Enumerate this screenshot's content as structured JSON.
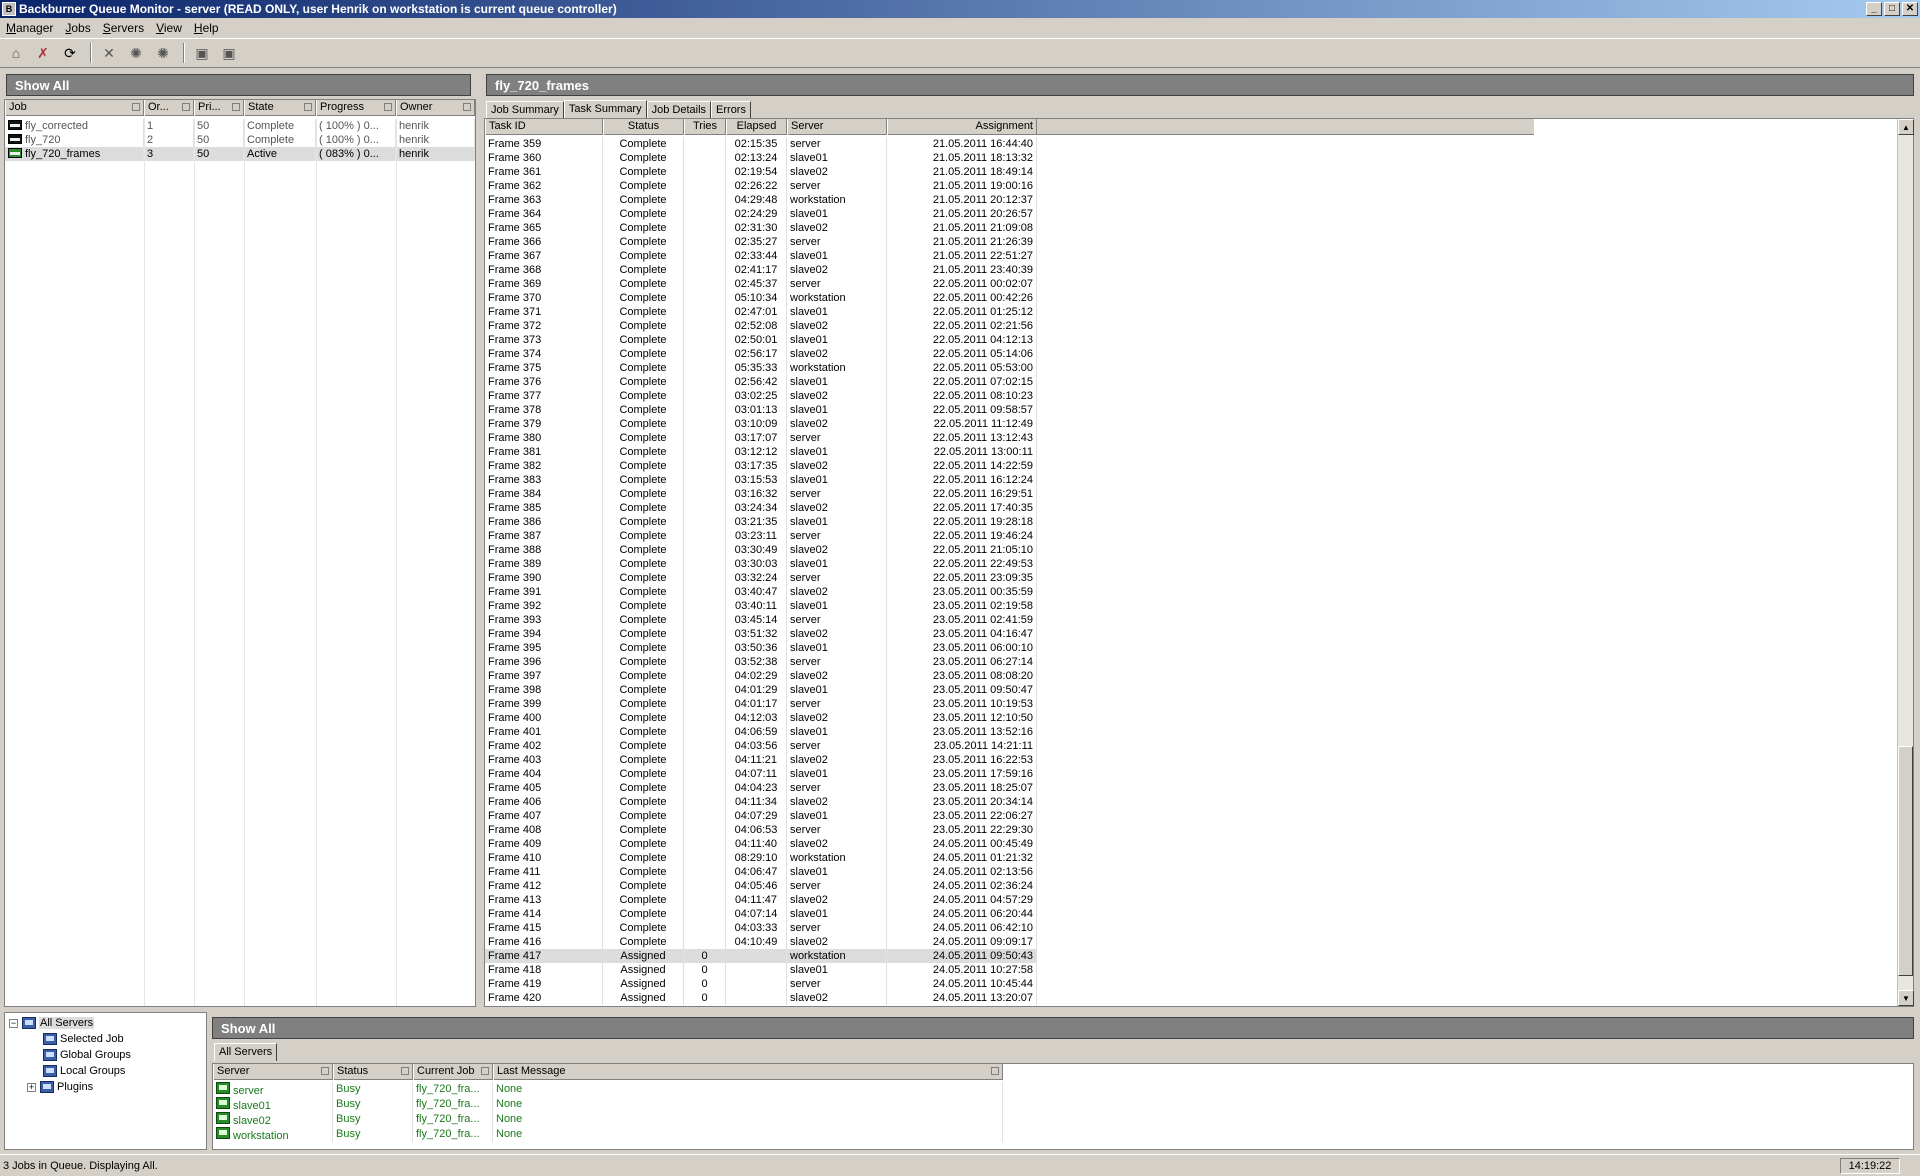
{
  "window": {
    "title": "Backburner Queue Monitor - server (READ ONLY, user Henrik on workstation is current queue controller)"
  },
  "menu": [
    {
      "label": "Manager",
      "accel": "M",
      "rest": "anager"
    },
    {
      "label": "Jobs",
      "accel": "J",
      "rest": "obs"
    },
    {
      "label": "Servers",
      "accel": "S",
      "rest": "ervers"
    },
    {
      "label": "View",
      "accel": "V",
      "rest": "iew"
    },
    {
      "label": "Help",
      "accel": "H",
      "rest": "elp"
    }
  ],
  "jobs_panel": {
    "header": "Show All",
    "columns": [
      "Job",
      "Or...",
      "Pri...",
      "State",
      "Progress",
      "Owner"
    ],
    "rows": [
      {
        "job": "fly_corrected",
        "order": "1",
        "priority": "50",
        "state": "Complete",
        "progress": "( 100% ) 0...",
        "owner": "henrik",
        "active": false
      },
      {
        "job": "fly_720",
        "order": "2",
        "priority": "50",
        "state": "Complete",
        "progress": "( 100% ) 0...",
        "owner": "henrik",
        "active": false
      },
      {
        "job": "fly_720_frames",
        "order": "3",
        "priority": "50",
        "state": "Active",
        "progress": "( 083% ) 0...",
        "owner": "henrik",
        "active": true
      }
    ]
  },
  "task_panel": {
    "header": "fly_720_frames",
    "tabs": [
      "Job Summary",
      "Task Summary",
      "Job Details",
      "Errors"
    ],
    "active_tab": "Task Summary",
    "columns": [
      "Task ID",
      "Status",
      "Tries",
      "Elapsed",
      "Server",
      "Assignment"
    ],
    "rows": [
      [
        "Frame 359",
        "Complete",
        "",
        "02:15:35",
        "server",
        "21.05.2011 16:44:40"
      ],
      [
        "Frame 360",
        "Complete",
        "",
        "02:13:24",
        "slave01",
        "21.05.2011 18:13:32"
      ],
      [
        "Frame 361",
        "Complete",
        "",
        "02:19:54",
        "slave02",
        "21.05.2011 18:49:14"
      ],
      [
        "Frame 362",
        "Complete",
        "",
        "02:26:22",
        "server",
        "21.05.2011 19:00:16"
      ],
      [
        "Frame 363",
        "Complete",
        "",
        "04:29:48",
        "workstation",
        "21.05.2011 20:12:37"
      ],
      [
        "Frame 364",
        "Complete",
        "",
        "02:24:29",
        "slave01",
        "21.05.2011 20:26:57"
      ],
      [
        "Frame 365",
        "Complete",
        "",
        "02:31:30",
        "slave02",
        "21.05.2011 21:09:08"
      ],
      [
        "Frame 366",
        "Complete",
        "",
        "02:35:27",
        "server",
        "21.05.2011 21:26:39"
      ],
      [
        "Frame 367",
        "Complete",
        "",
        "02:33:44",
        "slave01",
        "21.05.2011 22:51:27"
      ],
      [
        "Frame 368",
        "Complete",
        "",
        "02:41:17",
        "slave02",
        "21.05.2011 23:40:39"
      ],
      [
        "Frame 369",
        "Complete",
        "",
        "02:45:37",
        "server",
        "22.05.2011 00:02:07"
      ],
      [
        "Frame 370",
        "Complete",
        "",
        "05:10:34",
        "workstation",
        "22.05.2011 00:42:26"
      ],
      [
        "Frame 371",
        "Complete",
        "",
        "02:47:01",
        "slave01",
        "22.05.2011 01:25:12"
      ],
      [
        "Frame 372",
        "Complete",
        "",
        "02:52:08",
        "slave02",
        "22.05.2011 02:21:56"
      ],
      [
        "Frame 373",
        "Complete",
        "",
        "02:50:01",
        "slave01",
        "22.05.2011 04:12:13"
      ],
      [
        "Frame 374",
        "Complete",
        "",
        "02:56:17",
        "slave02",
        "22.05.2011 05:14:06"
      ],
      [
        "Frame 375",
        "Complete",
        "",
        "05:35:33",
        "workstation",
        "22.05.2011 05:53:00"
      ],
      [
        "Frame 376",
        "Complete",
        "",
        "02:56:42",
        "slave01",
        "22.05.2011 07:02:15"
      ],
      [
        "Frame 377",
        "Complete",
        "",
        "03:02:25",
        "slave02",
        "22.05.2011 08:10:23"
      ],
      [
        "Frame 378",
        "Complete",
        "",
        "03:01:13",
        "slave01",
        "22.05.2011 09:58:57"
      ],
      [
        "Frame 379",
        "Complete",
        "",
        "03:10:09",
        "slave02",
        "22.05.2011 11:12:49"
      ],
      [
        "Frame 380",
        "Complete",
        "",
        "03:17:07",
        "server",
        "22.05.2011 13:12:43"
      ],
      [
        "Frame 381",
        "Complete",
        "",
        "03:12:12",
        "slave01",
        "22.05.2011 13:00:11"
      ],
      [
        "Frame 382",
        "Complete",
        "",
        "03:17:35",
        "slave02",
        "22.05.2011 14:22:59"
      ],
      [
        "Frame 383",
        "Complete",
        "",
        "03:15:53",
        "slave01",
        "22.05.2011 16:12:24"
      ],
      [
        "Frame 384",
        "Complete",
        "",
        "03:16:32",
        "server",
        "22.05.2011 16:29:51"
      ],
      [
        "Frame 385",
        "Complete",
        "",
        "03:24:34",
        "slave02",
        "22.05.2011 17:40:35"
      ],
      [
        "Frame 386",
        "Complete",
        "",
        "03:21:35",
        "slave01",
        "22.05.2011 19:28:18"
      ],
      [
        "Frame 387",
        "Complete",
        "",
        "03:23:11",
        "server",
        "22.05.2011 19:46:24"
      ],
      [
        "Frame 388",
        "Complete",
        "",
        "03:30:49",
        "slave02",
        "22.05.2011 21:05:10"
      ],
      [
        "Frame 389",
        "Complete",
        "",
        "03:30:03",
        "slave01",
        "22.05.2011 22:49:53"
      ],
      [
        "Frame 390",
        "Complete",
        "",
        "03:32:24",
        "server",
        "22.05.2011 23:09:35"
      ],
      [
        "Frame 391",
        "Complete",
        "",
        "03:40:47",
        "slave02",
        "23.05.2011 00:35:59"
      ],
      [
        "Frame 392",
        "Complete",
        "",
        "03:40:11",
        "slave01",
        "23.05.2011 02:19:58"
      ],
      [
        "Frame 393",
        "Complete",
        "",
        "03:45:14",
        "server",
        "23.05.2011 02:41:59"
      ],
      [
        "Frame 394",
        "Complete",
        "",
        "03:51:32",
        "slave02",
        "23.05.2011 04:16:47"
      ],
      [
        "Frame 395",
        "Complete",
        "",
        "03:50:36",
        "slave01",
        "23.05.2011 06:00:10"
      ],
      [
        "Frame 396",
        "Complete",
        "",
        "03:52:38",
        "server",
        "23.05.2011 06:27:14"
      ],
      [
        "Frame 397",
        "Complete",
        "",
        "04:02:29",
        "slave02",
        "23.05.2011 08:08:20"
      ],
      [
        "Frame 398",
        "Complete",
        "",
        "04:01:29",
        "slave01",
        "23.05.2011 09:50:47"
      ],
      [
        "Frame 399",
        "Complete",
        "",
        "04:01:17",
        "server",
        "23.05.2011 10:19:53"
      ],
      [
        "Frame 400",
        "Complete",
        "",
        "04:12:03",
        "slave02",
        "23.05.2011 12:10:50"
      ],
      [
        "Frame 401",
        "Complete",
        "",
        "04:06:59",
        "slave01",
        "23.05.2011 13:52:16"
      ],
      [
        "Frame 402",
        "Complete",
        "",
        "04:03:56",
        "server",
        "23.05.2011 14:21:11"
      ],
      [
        "Frame 403",
        "Complete",
        "",
        "04:11:21",
        "slave02",
        "23.05.2011 16:22:53"
      ],
      [
        "Frame 404",
        "Complete",
        "",
        "04:07:11",
        "slave01",
        "23.05.2011 17:59:16"
      ],
      [
        "Frame 405",
        "Complete",
        "",
        "04:04:23",
        "server",
        "23.05.2011 18:25:07"
      ],
      [
        "Frame 406",
        "Complete",
        "",
        "04:11:34",
        "slave02",
        "23.05.2011 20:34:14"
      ],
      [
        "Frame 407",
        "Complete",
        "",
        "04:07:29",
        "slave01",
        "23.05.2011 22:06:27"
      ],
      [
        "Frame 408",
        "Complete",
        "",
        "04:06:53",
        "server",
        "23.05.2011 22:29:30"
      ],
      [
        "Frame 409",
        "Complete",
        "",
        "04:11:40",
        "slave02",
        "24.05.2011 00:45:49"
      ],
      [
        "Frame 410",
        "Complete",
        "",
        "08:29:10",
        "workstation",
        "24.05.2011 01:21:32"
      ],
      [
        "Frame 411",
        "Complete",
        "",
        "04:06:47",
        "slave01",
        "24.05.2011 02:13:56"
      ],
      [
        "Frame 412",
        "Complete",
        "",
        "04:05:46",
        "server",
        "24.05.2011 02:36:24"
      ],
      [
        "Frame 413",
        "Complete",
        "",
        "04:11:47",
        "slave02",
        "24.05.2011 04:57:29"
      ],
      [
        "Frame 414",
        "Complete",
        "",
        "04:07:14",
        "slave01",
        "24.05.2011 06:20:44"
      ],
      [
        "Frame 415",
        "Complete",
        "",
        "04:03:33",
        "server",
        "24.05.2011 06:42:10"
      ],
      [
        "Frame 416",
        "Complete",
        "",
        "04:10:49",
        "slave02",
        "24.05.2011 09:09:17"
      ],
      [
        "Frame 417",
        "Assigned",
        "0",
        "",
        "workstation",
        "24.05.2011 09:50:43"
      ],
      [
        "Frame 418",
        "Assigned",
        "0",
        "",
        "slave01",
        "24.05.2011 10:27:58"
      ],
      [
        "Frame 419",
        "Assigned",
        "0",
        "",
        "server",
        "24.05.2011 10:45:44"
      ],
      [
        "Frame 420",
        "Assigned",
        "0",
        "",
        "slave02",
        "24.05.2011 13:20:07"
      ]
    ],
    "selected_row": "Frame 417"
  },
  "server_tree": {
    "root": "All Servers",
    "children": [
      "Selected Job",
      "Global Groups",
      "Local Groups",
      "Plugins"
    ]
  },
  "servers_panel": {
    "header": "Show All",
    "tab": "All Servers",
    "columns": [
      "Server",
      "Status",
      "Current Job",
      "Last Message"
    ],
    "rows": [
      {
        "server": "server",
        "status": "Busy",
        "job": "fly_720_fra...",
        "message": "None"
      },
      {
        "server": "slave01",
        "status": "Busy",
        "job": "fly_720_fra...",
        "message": "None"
      },
      {
        "server": "slave02",
        "status": "Busy",
        "job": "fly_720_fra...",
        "message": "None"
      },
      {
        "server": "workstation",
        "status": "Busy",
        "job": "fly_720_fra...",
        "message": "None"
      }
    ]
  },
  "statusbar": {
    "message": "3 Jobs in Queue. Displaying All.",
    "clock": "14:19:22"
  },
  "icons": {
    "app": "backburner-icon",
    "toolbar": [
      "connect-icon",
      "disconnect-icon",
      "refresh-icon",
      "delete-icon",
      "bug-icon",
      "bug-icon",
      "monitor-icon",
      "monitor-icon"
    ]
  }
}
